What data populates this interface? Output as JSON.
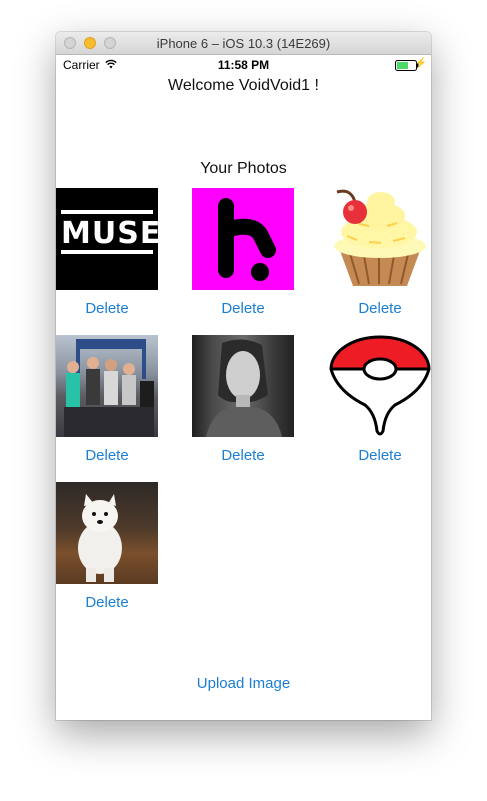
{
  "window": {
    "title": "iPhone 6 – iOS 10.3 (14E269)"
  },
  "status_bar": {
    "carrier": "Carrier",
    "time": "11:58 PM"
  },
  "header": {
    "welcome": "Welcome VoidVoid1 !"
  },
  "gallery": {
    "heading": "Your Photos",
    "photos": [
      {
        "subject": "muse-logo",
        "logo_text": "MUSE",
        "delete_label": "Delete"
      },
      {
        "subject": "magenta-h-logo",
        "delete_label": "Delete"
      },
      {
        "subject": "cupcake",
        "delete_label": "Delete"
      },
      {
        "subject": "marathon-runners",
        "delete_label": "Delete"
      },
      {
        "subject": "woman-portrait-bw",
        "delete_label": "Delete"
      },
      {
        "subject": "pokeball-map-pin",
        "delete_label": "Delete"
      },
      {
        "subject": "white-dog",
        "delete_label": "Delete"
      }
    ]
  },
  "actions": {
    "upload_label": "Upload Image"
  },
  "colors": {
    "link": "#1a7fd4",
    "battery_fill": "#4cd964",
    "brand_magenta": "#ff00ff"
  }
}
